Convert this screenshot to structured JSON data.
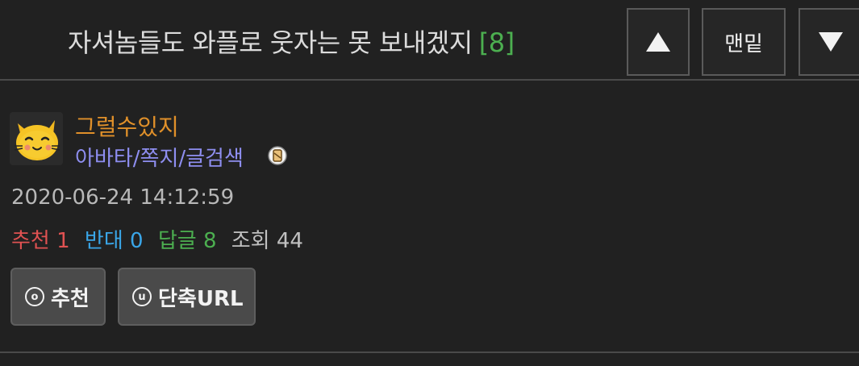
{
  "header": {
    "title": "자셔놈들도 와플로 웃자는 못 보내겠지",
    "comment_count": "[8]",
    "bottom_label": "맨밑",
    "up_icon": "triangle-up-icon",
    "down_icon": "triangle-down-icon"
  },
  "author": {
    "name": "그럴수있지",
    "links": "아바타/쪽지/글검색",
    "avatar_icon": "yellow-cat-avatar",
    "badge_icon": "hourglass-badge-icon"
  },
  "post": {
    "date": "2020-06-24 14:12:59",
    "stats": {
      "recommend_label": "추천",
      "recommend_value": "1",
      "oppose_label": "반대",
      "oppose_value": "0",
      "reply_label": "답글",
      "reply_value": "8",
      "view_label": "조회",
      "view_value": "44"
    }
  },
  "actions": {
    "recommend_label": "추천",
    "recommend_icon_glyph": "o",
    "short_url_label": "단축URL",
    "short_url_icon_glyph": "u"
  },
  "colors": {
    "background": "#212121",
    "author": "#e0902a",
    "links": "#8e8ef0",
    "recommend": "#e05252",
    "oppose": "#3aa6e8",
    "reply": "#4caf50"
  }
}
